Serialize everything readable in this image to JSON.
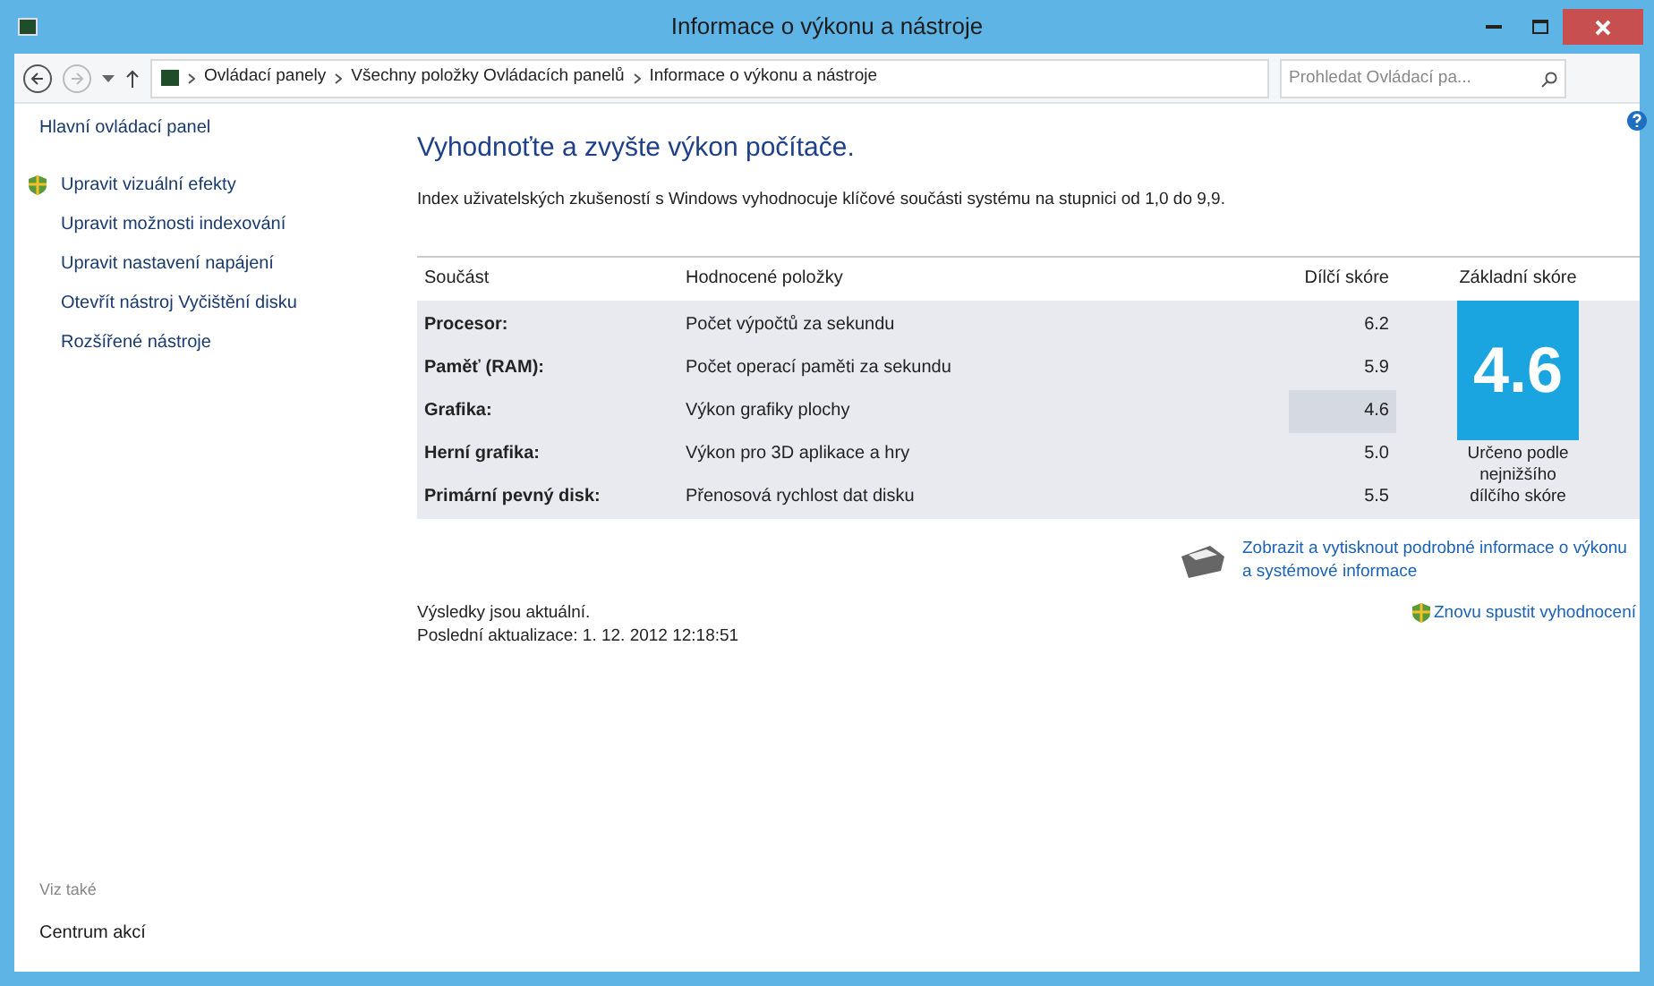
{
  "window": {
    "title": "Informace o výkonu a nástroje"
  },
  "address_bar": {
    "crumbs": [
      "Ovládací panely",
      "Všechny položky Ovládacích panelů",
      "Informace o výkonu a nástroje"
    ]
  },
  "search": {
    "placeholder": "Prohledat Ovládací pa..."
  },
  "sidebar": {
    "home": "Hlavní ovládací panel",
    "items": [
      {
        "label": "Upravit vizuální efekty",
        "kind": "shield"
      },
      {
        "label": "Upravit možnosti indexování",
        "kind": "plain"
      },
      {
        "label": "Upravit nastavení napájení",
        "kind": "plain"
      },
      {
        "label": "Otevřít nástroj Vyčištění disku",
        "kind": "plain"
      },
      {
        "label": "Rozšířené nástroje",
        "kind": "plain"
      }
    ],
    "see_also_heading": "Viz také",
    "see_also": [
      "Centrum akcí"
    ]
  },
  "heading": "Vyhodnoťte a zvyšte výkon počítače.",
  "description": "Index uživatelských zkušeností s Windows vyhodnocuje klíčové součásti systému na stupnici od 1,0 do 9,9.",
  "table": {
    "columns": [
      "Součást",
      "Hodnocené položky",
      "Dílčí skóre",
      "Základní skóre"
    ],
    "rows": [
      {
        "component": "Procesor:",
        "rated": "Počet výpočtů za sekundu",
        "score": "6.2",
        "lowest": false
      },
      {
        "component": "Paměť (RAM):",
        "rated": "Počet operací paměti za sekundu",
        "score": "5.9",
        "lowest": false
      },
      {
        "component": "Grafika:",
        "rated": "Výkon grafiky plochy",
        "score": "4.6",
        "lowest": true
      },
      {
        "component": "Herní grafika:",
        "rated": "Výkon pro 3D aplikace a hry",
        "score": "5.0",
        "lowest": false
      },
      {
        "component": "Primární pevný disk:",
        "rated": "Přenosová rychlost dat disku",
        "score": "5.5",
        "lowest": false
      }
    ],
    "base_score": "4.6",
    "base_note": "Určeno podle nejnižšího dílčího skóre"
  },
  "print_link": "Zobrazit a vytisknout podrobné informace o výkonu a systémové informace",
  "status": "Výsledky jsou aktuální.",
  "last_update": "Poslední aktualizace: 1. 12. 2012 12:18:51",
  "rerun_link": "Znovu spustit vyhodnocení"
}
